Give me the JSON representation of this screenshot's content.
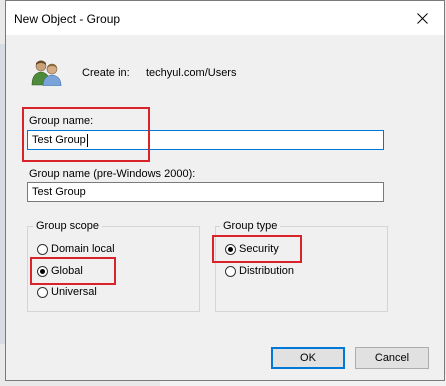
{
  "window": {
    "title": "New Object - Group"
  },
  "create_in": {
    "label": "Create in:",
    "path": "techyul.com/Users"
  },
  "group_name": {
    "label": "Group name:",
    "value": "Test Group"
  },
  "group_name_pre2000": {
    "label": "Group name (pre-Windows 2000):",
    "value": "Test Group"
  },
  "group_scope": {
    "title": "Group scope",
    "options": [
      {
        "label": "Domain local",
        "checked": false
      },
      {
        "label": "Global",
        "checked": true
      },
      {
        "label": "Universal",
        "checked": false
      }
    ]
  },
  "group_type": {
    "title": "Group type",
    "options": [
      {
        "label": "Security",
        "checked": true
      },
      {
        "label": "Distribution",
        "checked": false
      }
    ]
  },
  "buttons": {
    "ok": "OK",
    "cancel": "Cancel"
  },
  "colors": {
    "highlight": "#d9232a",
    "focus": "#0078d7"
  },
  "icons": {
    "close": "close-icon",
    "group": "group-users-icon"
  }
}
